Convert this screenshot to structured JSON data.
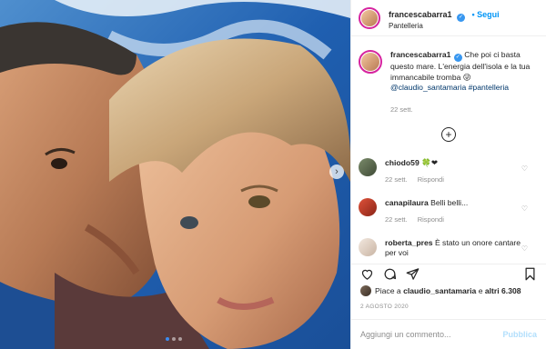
{
  "post": {
    "username": "francescabarra1",
    "follow_label": "Segui",
    "location": "Pantelleria",
    "more_icon": "more-horizontal-icon"
  },
  "caption": {
    "username": "francescabarra1",
    "text": "Che poi ci basta questo mare. L'energia dell'isola e la tua immancabile tromba",
    "emoji": "😜",
    "mention": "@claudio_santamaria",
    "hashtag": "#pantelleria",
    "time": "22 sett."
  },
  "load_more_icon": "plus-circle-icon",
  "comments": [
    {
      "username": "chiodo59",
      "text": "",
      "emoji": "🍀❤",
      "time": "22 sett.",
      "reply_label": "Rispondi"
    },
    {
      "username": "canapilaura",
      "text": "Belli belli...",
      "time": "22 sett.",
      "reply_label": "Rispondi"
    },
    {
      "username": "roberta_pres",
      "text": "È stato un onore cantare per voi",
      "time": "",
      "reply_label": ""
    }
  ],
  "actions": {
    "like_icon": "heart-icon",
    "comment_icon": "comment-icon",
    "share_icon": "paper-plane-icon",
    "save_icon": "bookmark-icon"
  },
  "likes": {
    "prefix": "Piace a",
    "user": "claudio_santamaria",
    "middle": "e",
    "others": "altri 6.308"
  },
  "date": "2 AGOSTO 2020",
  "comment_box": {
    "placeholder": "Aggiungi un commento...",
    "publish_label": "Pubblica"
  },
  "carousel": {
    "next_icon": "chevron-right-icon",
    "dot_count": 3,
    "active_dot": 1
  },
  "colors": {
    "accent": "#0095f6",
    "verified": "#3897f0",
    "muted": "#8e8e8e"
  }
}
